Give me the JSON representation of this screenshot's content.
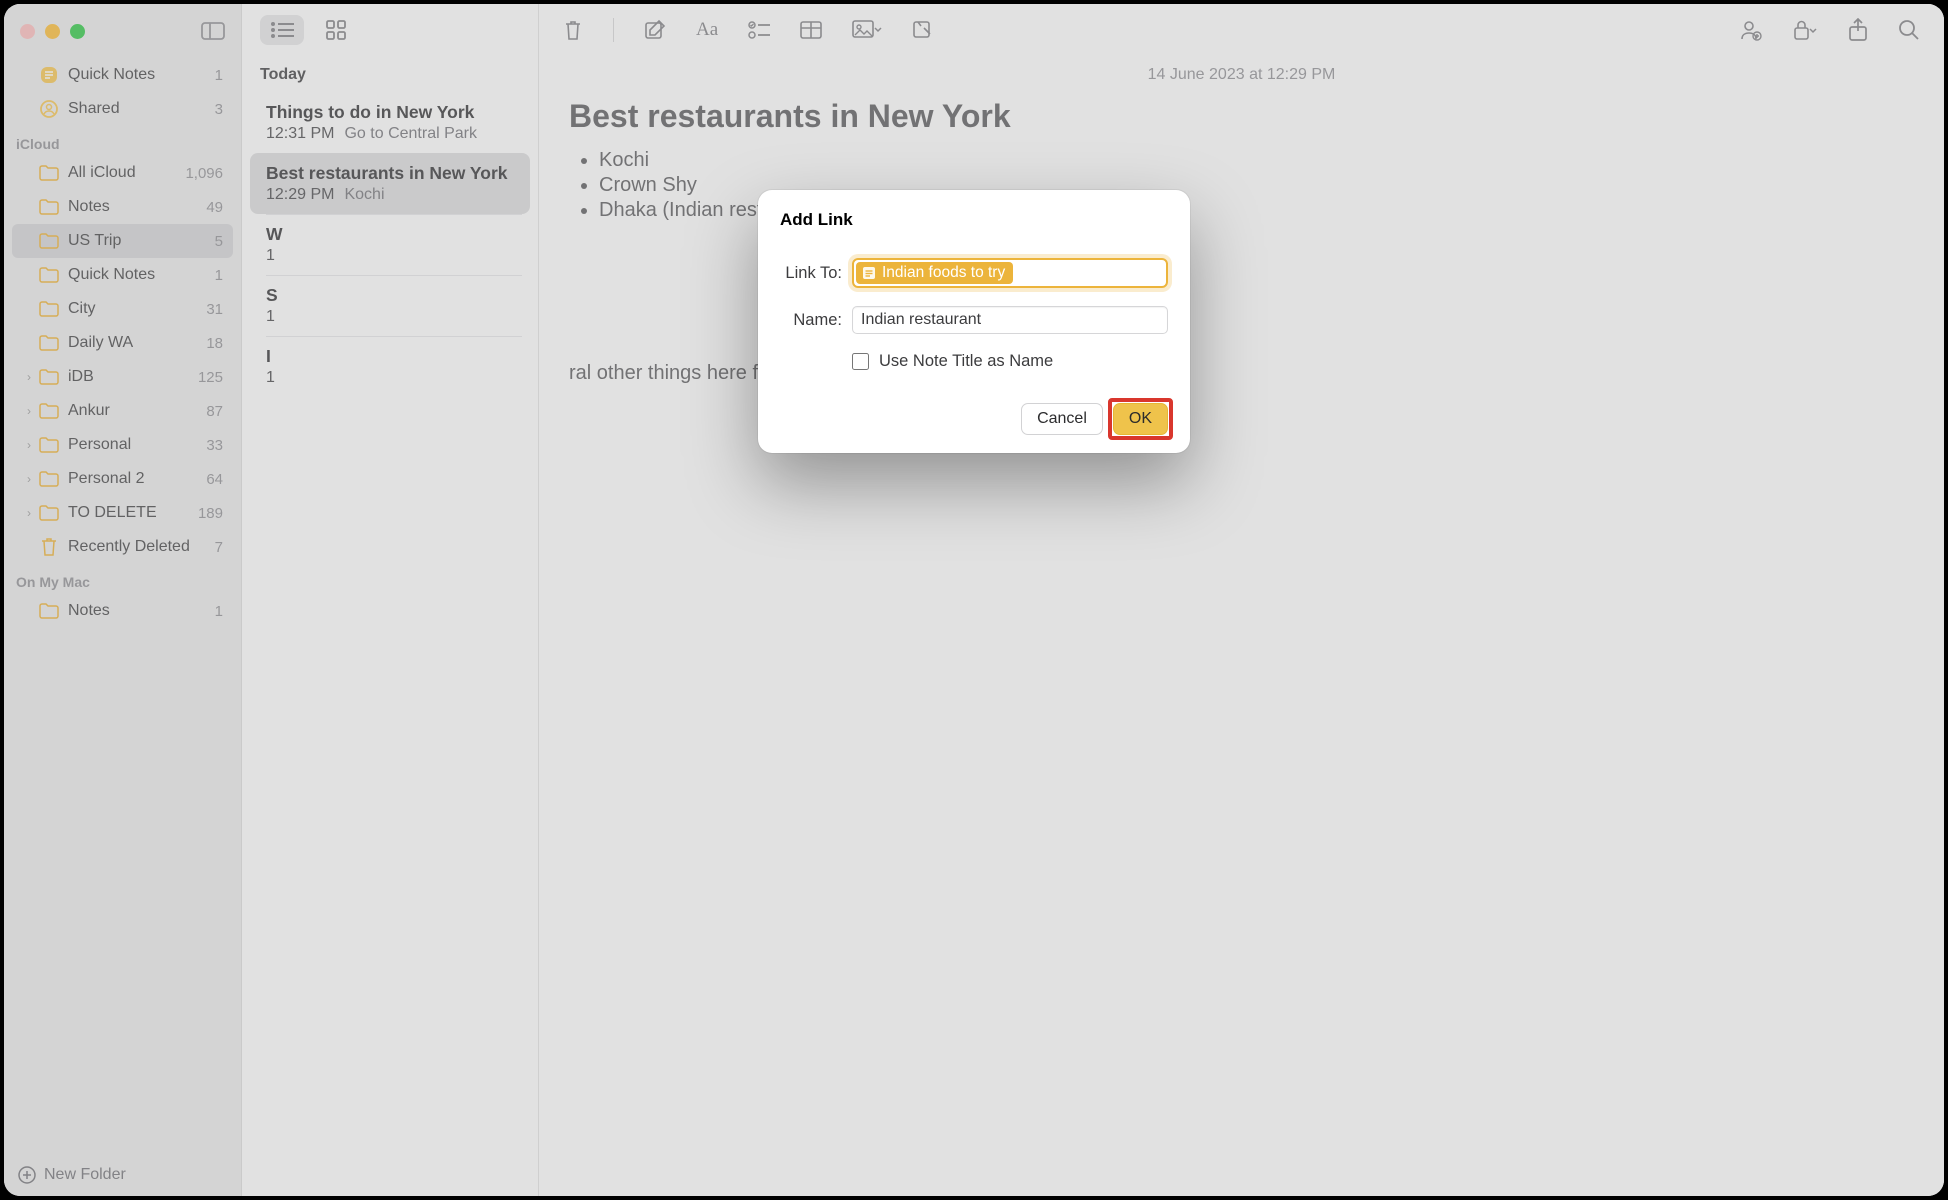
{
  "sidebar": {
    "top_items": [
      {
        "label": "Quick Notes",
        "count": "1",
        "icon": "quicknote"
      },
      {
        "label": "Shared",
        "count": "3",
        "icon": "shared"
      }
    ],
    "sections": [
      {
        "title": "iCloud",
        "items": [
          {
            "label": "All iCloud",
            "count": "1,096",
            "icon": "folder",
            "disclosure": ""
          },
          {
            "label": "Notes",
            "count": "49",
            "icon": "folder",
            "disclosure": ""
          },
          {
            "label": "US Trip",
            "count": "5",
            "icon": "folder",
            "selected": true,
            "disclosure": ""
          },
          {
            "label": "Quick Notes",
            "count": "1",
            "icon": "folder",
            "disclosure": ""
          },
          {
            "label": "City",
            "count": "31",
            "icon": "folder",
            "disclosure": ""
          },
          {
            "label": "Daily WA",
            "count": "18",
            "icon": "folder",
            "disclosure": ""
          },
          {
            "label": "iDB",
            "count": "125",
            "icon": "folder",
            "disclosure": "›"
          },
          {
            "label": "Ankur",
            "count": "87",
            "icon": "folder",
            "disclosure": "›"
          },
          {
            "label": "Personal",
            "count": "33",
            "icon": "folder",
            "disclosure": "›"
          },
          {
            "label": "Personal 2",
            "count": "64",
            "icon": "folder",
            "disclosure": "›"
          },
          {
            "label": "TO DELETE",
            "count": "189",
            "icon": "folder",
            "disclosure": "›"
          },
          {
            "label": "Recently Deleted",
            "count": "7",
            "icon": "trash",
            "disclosure": ""
          }
        ]
      },
      {
        "title": "On My Mac",
        "items": [
          {
            "label": "Notes",
            "count": "1",
            "icon": "folder",
            "disclosure": ""
          }
        ]
      }
    ],
    "new_folder_label": "New Folder"
  },
  "notelist": {
    "section_label": "Today",
    "rows": [
      {
        "title": "Things to do in New York",
        "time": "12:31 PM",
        "snippet": "Go to Central Park"
      },
      {
        "title": "Best restaurants in New York",
        "time": "12:29 PM",
        "snippet": "Kochi",
        "selected": true
      },
      {
        "title": "W",
        "time": "1",
        "snippet": ""
      },
      {
        "title": "S",
        "time": "1",
        "snippet": ""
      },
      {
        "title": "I",
        "time": "1",
        "snippet": ""
      }
    ]
  },
  "editor": {
    "date": "14 June 2023 at 12:29 PM",
    "title": "Best restaurants in New York",
    "bullets": [
      "Kochi",
      "Crown Shy",
      "Dhaka (Indian restaurant)"
    ],
    "extra_text": "ral other things here from small"
  },
  "modal": {
    "title": "Add Link",
    "link_to_label": "Link To:",
    "link_to_token": "Indian foods to try",
    "name_label": "Name:",
    "name_value": "Indian restaurant",
    "checkbox_label": "Use Note Title as Name",
    "cancel": "Cancel",
    "ok": "OK"
  }
}
